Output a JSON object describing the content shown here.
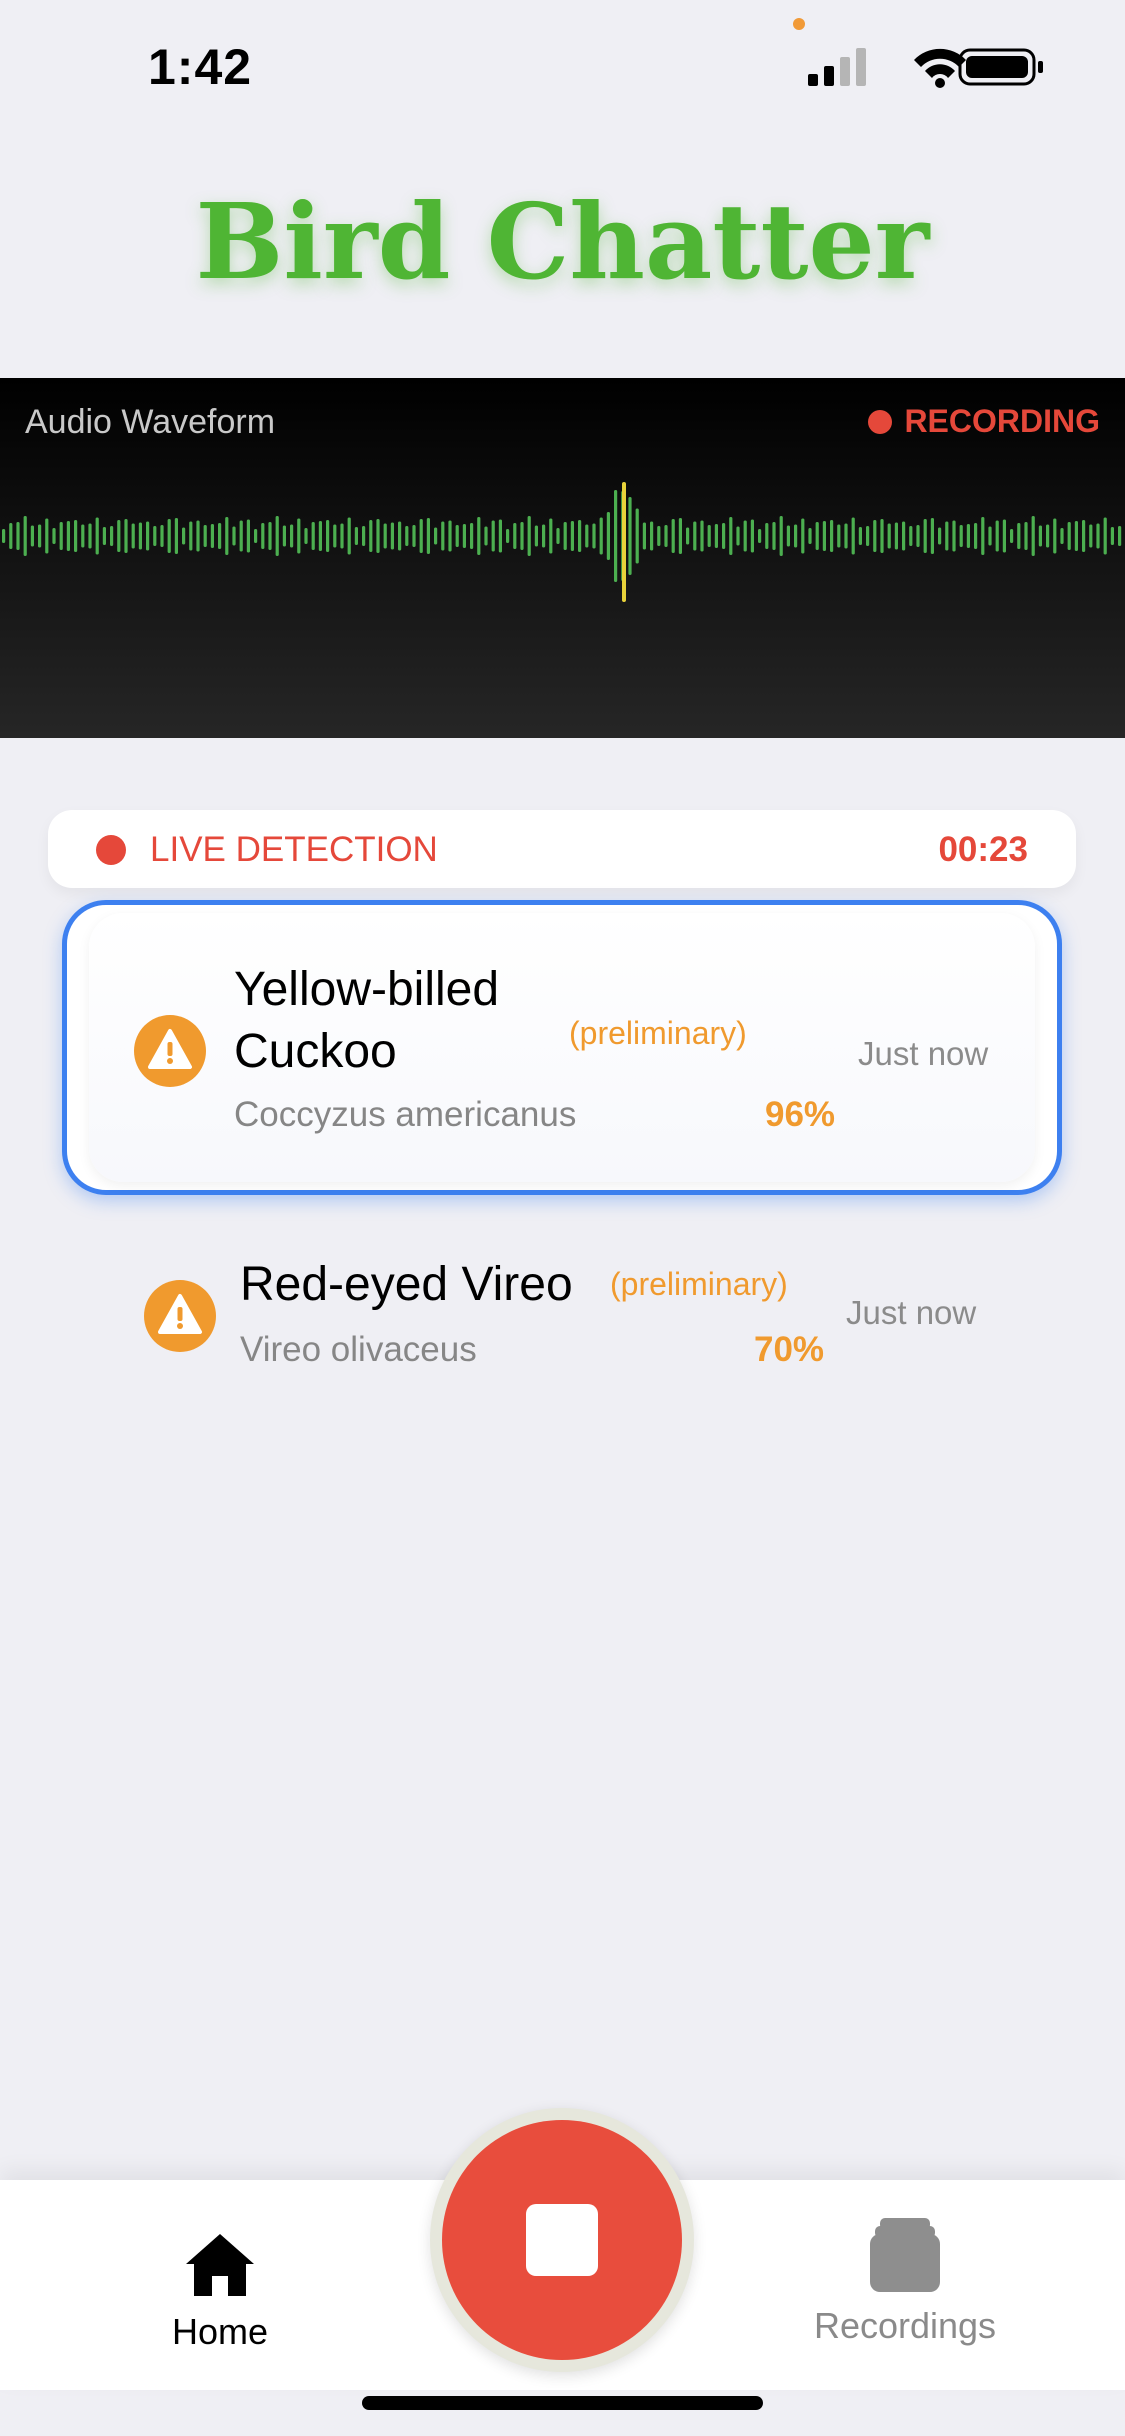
{
  "status_bar": {
    "time": "1:42"
  },
  "app": {
    "title": "Bird Chatter"
  },
  "waveform": {
    "label": "Audio Waveform",
    "recording_label": "RECORDING"
  },
  "live": {
    "label": "LIVE DETECTION",
    "timer": "00:23"
  },
  "detections": [
    {
      "name_line1": "Yellow-billed",
      "name_line2": "Cuckoo",
      "status": "(preliminary)",
      "scientific": "Coccyzus americanus",
      "confidence": "96%",
      "time": "Just now",
      "selected": true
    },
    {
      "name_line1": "Red-eyed Vireo",
      "status": "(preliminary)",
      "scientific": "Vireo olivaceus",
      "confidence": "70%",
      "time": "Just now",
      "selected": false
    }
  ],
  "tabs": {
    "home": "Home",
    "recordings": "Recordings"
  },
  "colors": {
    "title_green": "#4fb534",
    "record_red": "#e84d3d",
    "warning_orange": "#f09a2e",
    "selection_blue": "#3d80f0",
    "waveform_green": "#4caf50",
    "playhead_yellow": "#e8d23a"
  }
}
